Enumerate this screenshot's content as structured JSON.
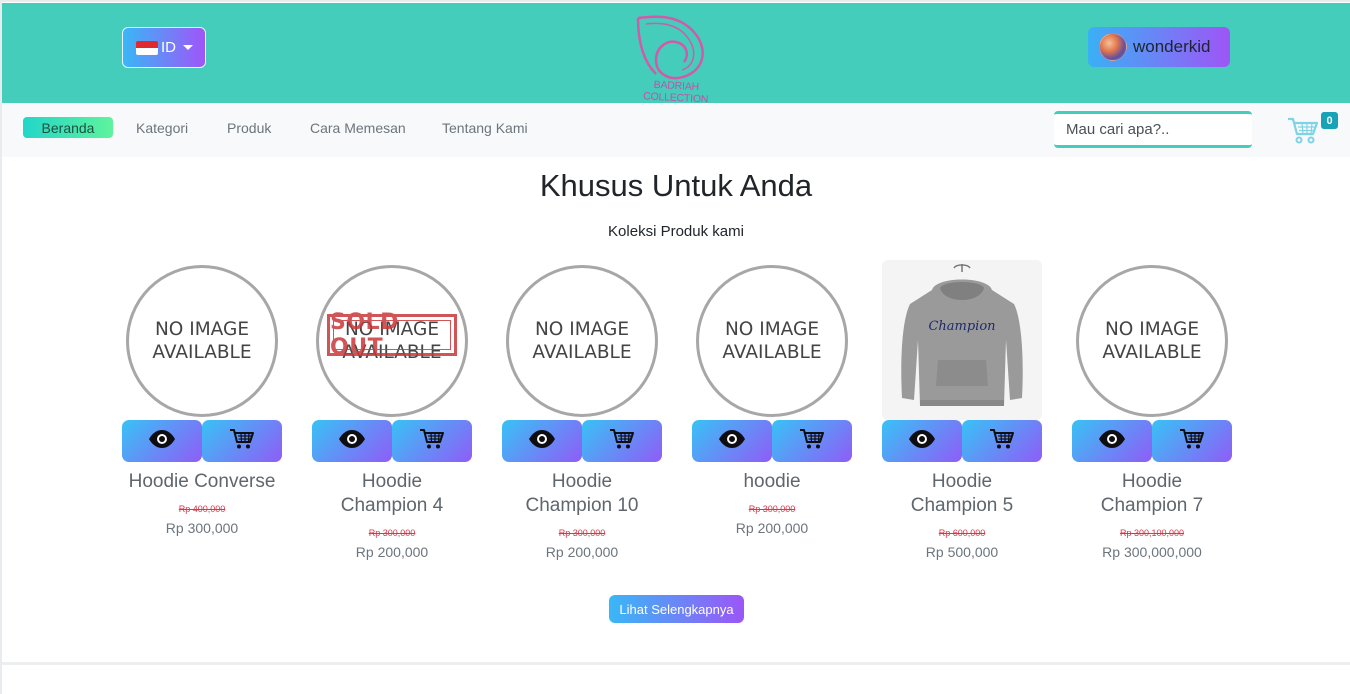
{
  "header": {
    "language_label": "ID",
    "logo_text": "BADRIAH COLLECTION",
    "username": "wonderkid"
  },
  "nav": {
    "items": [
      {
        "label": "Beranda",
        "active": true
      },
      {
        "label": "Kategori",
        "active": false
      },
      {
        "label": "Produk",
        "active": false
      },
      {
        "label": "Cara Memesan",
        "active": false
      },
      {
        "label": "Tentang Kami",
        "active": false
      }
    ],
    "search_placeholder": "Mau cari apa?..",
    "cart_count": "0"
  },
  "section": {
    "title": "Khusus Untuk Anda",
    "subtitle": "Koleksi Produk kami"
  },
  "placeholder_text": {
    "line1": "NO IMAGE",
    "line2": "AVAILABLE",
    "sold_out": "SOLD OUT"
  },
  "products": [
    {
      "name_lines": [
        "Hoodie Converse"
      ],
      "old_price": "Rp 400,000",
      "price": "Rp 300,000",
      "image": "no-image",
      "sold_out": false
    },
    {
      "name_lines": [
        "Hoodie",
        "Champion 4"
      ],
      "old_price": "Rp 300,000",
      "price": "Rp 200,000",
      "image": "no-image",
      "sold_out": true
    },
    {
      "name_lines": [
        "Hoodie",
        "Champion 10"
      ],
      "old_price": "Rp 300,000",
      "price": "Rp 200,000",
      "image": "no-image",
      "sold_out": false
    },
    {
      "name_lines": [
        "hoodie"
      ],
      "old_price": "Rp 300,000",
      "price": "Rp 200,000",
      "image": "no-image",
      "sold_out": false
    },
    {
      "name_lines": [
        "Hoodie",
        "Champion 5"
      ],
      "old_price": "Rp 600,000",
      "price": "Rp 500,000",
      "image": "grey-hoodie-photo",
      "sold_out": false
    },
    {
      "name_lines": [
        "Hoodie",
        "Champion 7"
      ],
      "old_price": "Rp 300,100,000",
      "price": "Rp 300,000,000",
      "image": "no-image",
      "sold_out": false
    }
  ],
  "actions": {
    "more_label": "Lihat Selengkapnya"
  },
  "colors": {
    "header_bg": "#44cdbb",
    "nav_bg": "#f8f9fa",
    "accent_gradient_start": "#38c2f6",
    "accent_gradient_end": "#9b56f7",
    "old_price": "#dc3545"
  }
}
